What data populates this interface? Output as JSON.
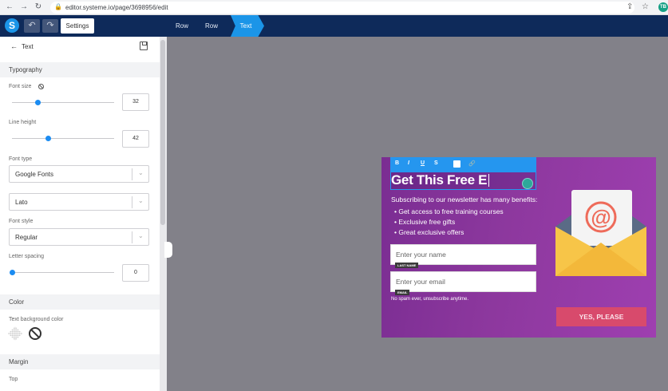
{
  "browser": {
    "url": "editor.systeme.io/page/3698956/edit",
    "profile_initials": "TB"
  },
  "topbar": {
    "logo_letter": "S",
    "undo_icon": "undo-icon",
    "redo_icon": "redo-icon",
    "settings_label": "Settings",
    "breadcrumbs": [
      "Row",
      "Row",
      "Text"
    ]
  },
  "panel": {
    "title": "Text",
    "sections": {
      "typography": "Typography",
      "color": "Color",
      "margin": "Margin"
    },
    "font_size": {
      "label": "Font size",
      "value": "32",
      "level": 0.28
    },
    "line_height": {
      "label": "Line height",
      "value": "42",
      "level": 0.36
    },
    "font_type": {
      "label": "Font type",
      "value": "Google Fonts"
    },
    "font_family": {
      "value": "Lato"
    },
    "font_style": {
      "label": "Font style",
      "value": "Regular"
    },
    "letter_spacing": {
      "label": "Letter spacing",
      "value": "0",
      "level": 0.0
    },
    "text_bg_color": {
      "label": "Text background color"
    },
    "margin_top": {
      "label": "Top"
    }
  },
  "popup": {
    "format_buttons": [
      "B",
      "I",
      "U",
      "S"
    ],
    "heading": "Get This Free E",
    "subtext": "Subscribing to our newsletter has many benefits:",
    "bullets": [
      "Get access to free training courses",
      "Exclusive free gifts",
      "Great exclusive offers"
    ],
    "name_placeholder": "Enter your name",
    "name_tag": "LAST NAME",
    "email_placeholder": "Enter your email",
    "email_tag": "EMAIL",
    "nospam": "No spam ever, unsubscribe anytime.",
    "cta": "YES, PLEASE",
    "envelope_symbol": "@"
  },
  "colors": {
    "topbar": "#0e2a5a",
    "accent": "#1b95e8",
    "popup_bg": "#8d389e",
    "cta": "#d84a6c"
  }
}
